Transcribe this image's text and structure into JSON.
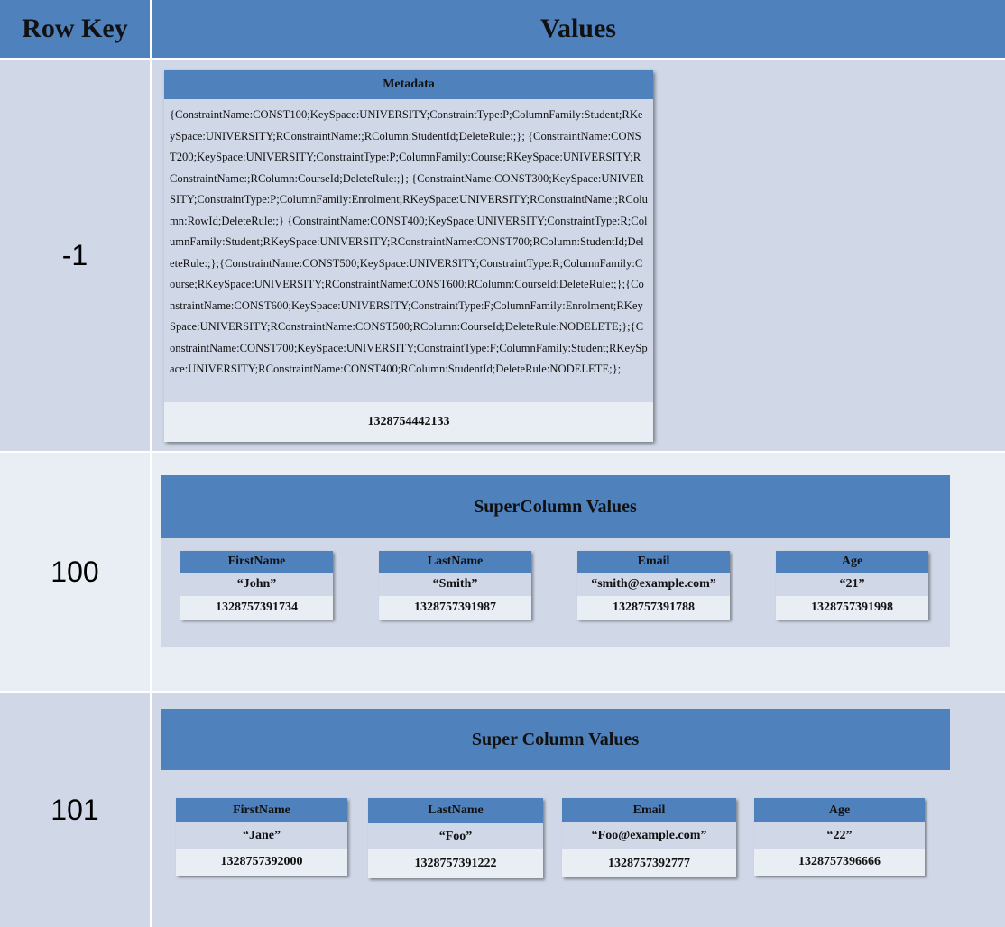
{
  "header": {
    "row_key": "Row Key",
    "values": "Values"
  },
  "rows": [
    {
      "key": "-1",
      "metadata": {
        "title": "Metadata",
        "text": "{ConstraintName:CONST100;KeySpace:UNIVERSITY;ConstraintType:P;ColumnFamily:Student;RKeySpace:UNIVERSITY;RConstraintName:;RColumn:StudentId;DeleteRule:;}; {ConstraintName:CONST200;KeySpace:UNIVERSITY;ConstraintType:P;ColumnFamily:Course;RKeySpace:UNIVERSITY;RConstraintName:;RColumn:CourseId;DeleteRule:;}; {ConstraintName:CONST300;KeySpace:UNIVERSITY;ConstraintType:P;ColumnFamily:Enrolment;RKeySpace:UNIVERSITY;RConstraintName:;RColumn:RowId;DeleteRule:;} {ConstraintName:CONST400;KeySpace:UNIVERSITY;ConstraintType:R;ColumnFamily:Student;RKeySpace:UNIVERSITY;RConstraintName:CONST700;RColumn:StudentId;DeleteRule:;};{ConstraintName:CONST500;KeySpace:UNIVERSITY;ConstraintType:R;ColumnFamily:Course;RKeySpace:UNIVERSITY;RConstraintName:CONST600;RColumn:CourseId;DeleteRule:;};{ConstraintName:CONST600;KeySpace:UNIVERSITY;ConstraintType:F;ColumnFamily:Enrolment;RKeySpace:UNIVERSITY;RConstraintName:CONST500;RColumn:CourseId;DeleteRule:NODELETE;};{ConstraintName:CONST700;KeySpace:UNIVERSITY;ConstraintType:F;ColumnFamily:Student;RKeySpace:UNIVERSITY;RConstraintName:CONST400;RColumn:StudentId;DeleteRule:NODELETE;};",
        "timestamp": "1328754442133"
      }
    },
    {
      "key": "100",
      "panel_title": "SuperColumn Values",
      "columns": [
        {
          "name": "FirstName",
          "value": "“John”",
          "timestamp": "1328757391734"
        },
        {
          "name": "LastName",
          "value": "“Smith”",
          "timestamp": "1328757391987"
        },
        {
          "name": "Email",
          "value": "“smith@example.com”",
          "timestamp": "1328757391788"
        },
        {
          "name": "Age",
          "value": "“21”",
          "timestamp": "1328757391998"
        }
      ]
    },
    {
      "key": "101",
      "panel_title": "Super Column Values",
      "columns": [
        {
          "name": "FirstName",
          "value": "“Jane”",
          "timestamp": "1328757392000"
        },
        {
          "name": "LastName",
          "value": "“Foo”",
          "timestamp": "1328757391222"
        },
        {
          "name": "Email",
          "value": "“Foo@example.com”",
          "timestamp": "1328757392777"
        },
        {
          "name": "Age",
          "value": "“22”",
          "timestamp": "1328757396666"
        }
      ]
    }
  ]
}
